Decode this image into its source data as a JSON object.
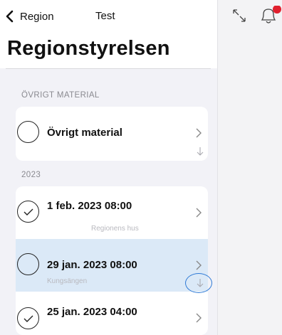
{
  "nav": {
    "back_label": "Region",
    "title": "Test"
  },
  "page": {
    "title": "Regionstyrelsen"
  },
  "sections": [
    {
      "header": "ÖVRIGT MATERIAL"
    },
    {
      "header": "2023"
    }
  ],
  "rows": [
    {
      "title": "Övrigt material",
      "subtitle": "",
      "checked": false,
      "download": true
    },
    {
      "title": "1 feb. 2023 08:00",
      "subtitle": "Regionens hus",
      "checked": true,
      "download": false
    },
    {
      "title": "29 jan. 2023 08:00",
      "subtitle": "Kungsängen",
      "checked": false,
      "download": true,
      "selected": true
    },
    {
      "title": "25 jan. 2023 04:00",
      "subtitle": "",
      "checked": true,
      "download": false
    }
  ],
  "icons": {
    "back": "chevron-left-icon",
    "expand": "expand-arrows-icon",
    "bell": "bell-icon",
    "row_chevron": "chevron-right-icon",
    "download": "download-arrow-icon",
    "check": "checkmark-icon"
  },
  "colors": {
    "accent": "#2f7ad6",
    "selected_row": "#dbe9f7",
    "badge": "#e0202e",
    "section_text": "#8a8a90"
  }
}
